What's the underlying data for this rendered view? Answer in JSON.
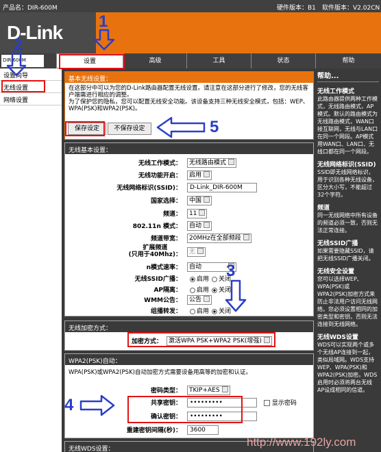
{
  "topbar": {
    "product": "产品名：DIR-600M",
    "hw": "硬件版本：B1",
    "sw": "软件版本：V2.02CN"
  },
  "logo": "D-Link",
  "model": "DIR-600M",
  "tabs": [
    "设置",
    "高级",
    "工具",
    "状态",
    "帮助"
  ],
  "sidebar": [
    "设置向导",
    "无线设置",
    "网络设置"
  ],
  "basic": {
    "title": "基本无线设置：",
    "desc": "在这部分中可以为您的D-Link路由器配置无线设置。请注意在这部分进行了修改，您的无线客户端需进行相应的调整。\n为了保护您的隐私，您可以配置无线安全功能。该设备支持三种无线安全模式，包括：WEP、WPA(PSK)和WPA2(PSK)。",
    "save": "保存设定",
    "nosave": "不保存设定"
  },
  "wireless": {
    "title": "无线基本设置：",
    "rows": [
      {
        "label": "无线工作模式：",
        "value": "无线路由模式"
      },
      {
        "label": "无线功能开启：",
        "value": "启用"
      },
      {
        "label": "无线网络标识(SSID)：",
        "value": "D-Link_DIR-600M"
      },
      {
        "label": "国家选择：",
        "value": "中国"
      },
      {
        "label": "频道：",
        "value": "11"
      },
      {
        "label": "802.11n 模式：",
        "value": "自动"
      },
      {
        "label": "频道带宽：",
        "value": "20MHz在全部频段"
      },
      {
        "label": "扩展频道\n(只用于40Mhz)：",
        "value": "无"
      },
      {
        "label": "n模式速率：",
        "value": "自动"
      },
      {
        "label": "无线SSID广播：",
        "opt1": "启用",
        "opt2": "关闭"
      },
      {
        "label": "AP隔离：",
        "opt1": "启用",
        "opt2": "关闭"
      },
      {
        "label": "WMM公告：",
        "value": "公告"
      },
      {
        "label": "组播转发：",
        "opt1": "启用",
        "opt2": "关闭"
      }
    ]
  },
  "enc": {
    "title": "无线加密方式：",
    "label": "加密方式：",
    "value": "激活WPA PSK+WPA2 PSK(增强)"
  },
  "wpa": {
    "title": "WPA2(PSK)自动：",
    "desc": "WPA(PSK)或WPA2(PSK)自动加密方式需要设备用高等的加密和认证。",
    "cipher_label": "密码类型：",
    "cipher": "TKIP+AES",
    "key_label": "共享密钥：",
    "key": "•••••••••",
    "show": "显示密码",
    "confirm_label": "确认密钥：",
    "confirm": "•••••••••",
    "interval_label": "重建密钥间隔(秒)：",
    "interval": "3600"
  },
  "wds": {
    "title": "无线WDS设置："
  },
  "help": {
    "header": "帮助...",
    "sections": [
      {
        "t": "无线工作模式",
        "b": "此路由器提供两种工作模式，无线路由模式，AP模式。默认的路由模式为无线路由模式，WAN口接互联网，无线与LAN口在同一个网段。AP模式用WAN口、LAN口、无线口都在同一个网段。"
      },
      {
        "t": "无线网络标识(SSID)",
        "b": "SSID即无线网络标识，用于识别各种无线设备，区分大小写，不能超过32个字符。"
      },
      {
        "t": "频道",
        "b": "同一无线网络中所有设备的频道必须一致，否则无法正常连接。"
      },
      {
        "t": "无线SSID广播",
        "b": "如果需要隐藏SSID，请把无线SSID广播关闭。"
      },
      {
        "t": "无线安全设置",
        "b": "您可以选择WEP、WPA(PSK)或WPA2(PSK)加密方式来防止非法用户访问无线网络。您必须设置相同的加密类型和密钥，否则无法连接到无线网络。"
      },
      {
        "t": "无线WDS设置",
        "b": "WDS可以实现两个或多个无线AP连接到一起，类似局域网。WDS支持WEP、WPA(PSK)和WPA2(PSK)加密。WDS启用时必须将两台无线AP设成相同的信道。"
      }
    ]
  },
  "annotations": [
    "1",
    "2",
    "3",
    "4",
    "5"
  ],
  "watermark": "http://www.192ly.com"
}
